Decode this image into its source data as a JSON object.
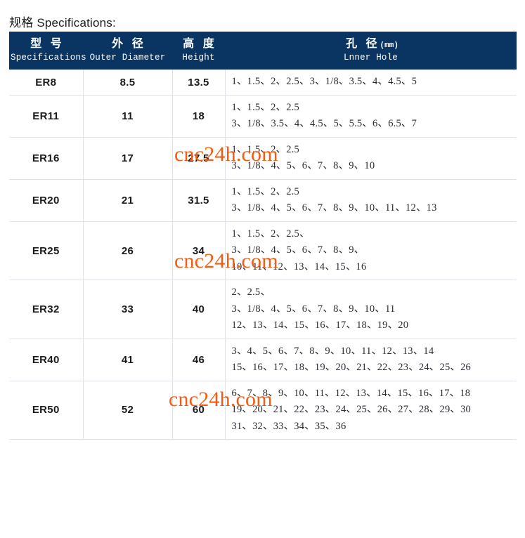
{
  "page": {
    "title": "规格 Specifications:"
  },
  "table": {
    "columns": [
      {
        "cn": "型  号",
        "en": "Specifications"
      },
      {
        "cn": "外  径",
        "en": "Outer Diameter"
      },
      {
        "cn": "高  度",
        "en": "Height"
      },
      {
        "cn": "孔  径",
        "cn_unit": "(mm)",
        "en": "Lnner Hole"
      }
    ],
    "rows": [
      {
        "model": "ER8",
        "outer_diameter": "8.5",
        "height": "13.5",
        "hole_lines": [
          "1、1.5、2、2.5、3、1/8、3.5、4、4.5、5"
        ]
      },
      {
        "model": "ER11",
        "outer_diameter": "11",
        "height": "18",
        "hole_lines": [
          "1、1.5、2、2.5",
          "3、1/8、3.5、4、4.5、5、5.5、6、6.5、7"
        ]
      },
      {
        "model": "ER16",
        "outer_diameter": "17",
        "height": "27.5",
        "hole_lines": [
          "1、1.5、2、2.5",
          "3、1/8、4、5、6、7、8、9、10"
        ]
      },
      {
        "model": "ER20",
        "outer_diameter": "21",
        "height": "31.5",
        "hole_lines": [
          "1、1.5、2、2.5",
          "3、1/8、4、5、6、7、8、9、10、11、12、13"
        ]
      },
      {
        "model": "ER25",
        "outer_diameter": "26",
        "height": "34",
        "hole_lines": [
          "1、1.5、2、2.5、",
          "3、1/8、4、5、6、7、8、9、",
          "10、11、12、13、14、15、16"
        ]
      },
      {
        "model": "ER32",
        "outer_diameter": "33",
        "height": "40",
        "hole_lines": [
          "2、2.5、",
          "3、1/8、4、5、6、7、8、9、10、11",
          "12、13、14、15、16、17、18、19、20"
        ]
      },
      {
        "model": "ER40",
        "outer_diameter": "41",
        "height": "46",
        "hole_lines": [
          "3、4、5、6、7、8、9、10、11、12、13、14",
          "15、16、17、18、19、20、21、22、23、24、25、26"
        ]
      },
      {
        "model": "ER50",
        "outer_diameter": "52",
        "height": "60",
        "hole_lines": [
          "6、7、8、9、10、11、12、13、14、15、16、17、18",
          "19、20、21、22、23、24、25、26、27、28、29、30",
          "31、32、33、34、35、36"
        ]
      }
    ]
  },
  "watermarks": [
    {
      "text": "cnc24h.com"
    },
    {
      "text": "cnc24h.com"
    },
    {
      "text": "cnc24h.com"
    }
  ],
  "colors": {
    "header_background": "#0a3563",
    "header_text": "#ffffff",
    "watermark": "#f25c13",
    "grid_line": "#dfe3e8",
    "body_text": "#1a1a1a"
  }
}
